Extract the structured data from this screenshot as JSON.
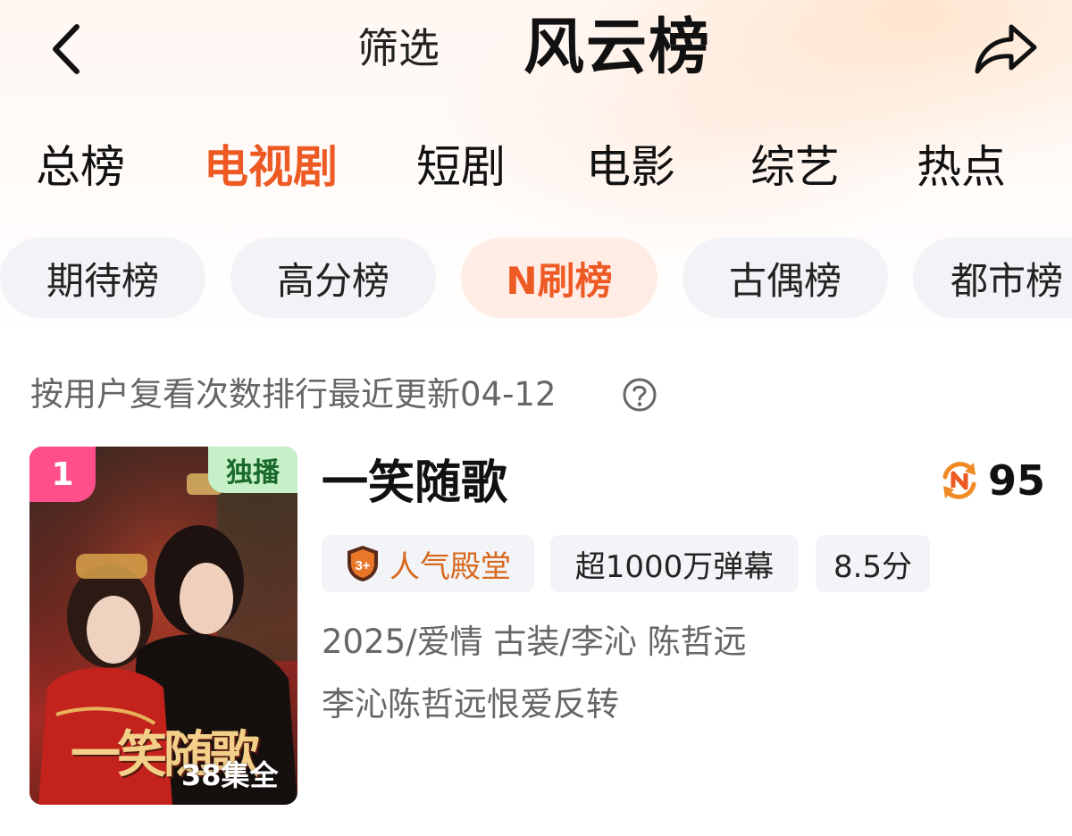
{
  "header": {
    "back_icon": "chevron-left-icon",
    "filter_label": "筛选",
    "title": "风云榜",
    "share_icon": "share-arrow-icon"
  },
  "main_tabs": [
    {
      "label": "总榜",
      "active": false
    },
    {
      "label": "电视剧",
      "active": true
    },
    {
      "label": "短剧",
      "active": false
    },
    {
      "label": "电影",
      "active": false
    },
    {
      "label": "综艺",
      "active": false
    },
    {
      "label": "热点",
      "active": false
    }
  ],
  "sub_tabs": [
    {
      "label": "期待榜",
      "active": false
    },
    {
      "label": "高分榜",
      "active": false
    },
    {
      "label": "N刷榜",
      "active": true
    },
    {
      "label": "古偶榜",
      "active": false
    },
    {
      "label": "都市榜",
      "active": false
    }
  ],
  "description": "按用户复看次数排行最近更新04-12",
  "help_icon": "question-circle-icon",
  "items": [
    {
      "rank": "1",
      "exclusive_badge": "独播",
      "poster_title": "一笑随歌",
      "episodes": "38集全",
      "title": "一笑随歌",
      "score_icon": "n-refresh-icon",
      "score": "95",
      "tags": {
        "hall_badge": "3+",
        "hall": "人气殿堂",
        "danmaku": "超1000万弹幕",
        "rating": "8.5分"
      },
      "meta": "2025/爱情 古装/李沁 陈哲远",
      "tagline": "李沁陈哲远恨爱反转"
    }
  ],
  "colors": {
    "accent": "#ee5a24",
    "rank_badge": "#ff4f8b",
    "exclusive_badge_bg": "#c6f0c8",
    "chip_bg": "#f2f3f6",
    "chip_active_bg": "#ffece4",
    "secondary_text": "#666666"
  }
}
